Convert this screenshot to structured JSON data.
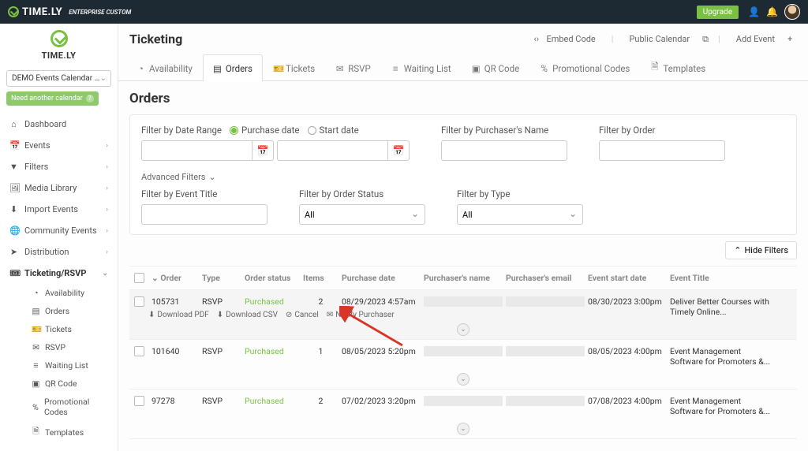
{
  "topbar": {
    "brand": "TIME.LY",
    "brand_sub": "ENTERPRISE CUSTOM",
    "upgrade": "Upgrade"
  },
  "sidebar": {
    "brand": "TIME.LY",
    "calendar_selected": "DEMO Events Calendar (M...",
    "need_calendar": "Need another calendar",
    "items": [
      {
        "icon": "⌂",
        "label": "Dashboard"
      },
      {
        "icon": "📅",
        "label": "Events",
        "chev": "›"
      },
      {
        "icon": "▼",
        "label": "Filters",
        "chev": "›"
      },
      {
        "icon": "🖼",
        "label": "Media Library",
        "chev": "›"
      },
      {
        "icon": "⬇",
        "label": "Import Events",
        "chev": "›"
      },
      {
        "icon": "🌐",
        "label": "Community Events",
        "chev": "›"
      },
      {
        "icon": "➤",
        "label": "Distribution",
        "chev": "›"
      },
      {
        "icon": "🎟",
        "label": "Ticketing/RSVP",
        "chev": "⌄",
        "active": true
      }
    ],
    "sub": [
      {
        "icon": "◔",
        "label": "Availability"
      },
      {
        "icon": "▤",
        "label": "Orders"
      },
      {
        "icon": "🎫",
        "label": "Tickets"
      },
      {
        "icon": "✉",
        "label": "RSVP"
      },
      {
        "icon": "≡",
        "label": "Waiting List"
      },
      {
        "icon": "▣",
        "label": "QR Code"
      },
      {
        "icon": "%",
        "label": "Promotional Codes"
      },
      {
        "icon": "🗎",
        "label": "Templates"
      }
    ]
  },
  "header": {
    "title": "Ticketing",
    "links": {
      "embed": "Embed Code",
      "public": "Public Calendar",
      "add": "Add Event"
    }
  },
  "tabs": [
    {
      "icon": "◔",
      "label": "Availability"
    },
    {
      "icon": "▤",
      "label": "Orders",
      "active": true
    },
    {
      "icon": "🎫",
      "label": "Tickets"
    },
    {
      "icon": "✉",
      "label": "RSVP"
    },
    {
      "icon": "≡",
      "label": "Waiting List"
    },
    {
      "icon": "▣",
      "label": "QR Code"
    },
    {
      "icon": "%",
      "label": "Promotional Codes"
    },
    {
      "icon": "🗎",
      "label": "Templates"
    }
  ],
  "page": {
    "title": "Orders",
    "filter_date_label": "Filter by Date Range",
    "purchase_date": "Purchase date",
    "start_date": "Start date",
    "filter_name": "Filter by Purchaser's Name",
    "filter_order": "Filter by Order",
    "advanced": "Advanced Filters",
    "filter_event": "Filter by Event Title",
    "filter_status": "Filter by Order Status",
    "filter_type": "Filter by Type",
    "all": "All",
    "hide": "Hide Filters"
  },
  "columns": {
    "order": "Order",
    "type": "Type",
    "status": "Order status",
    "items": "Items",
    "pdate": "Purchase date",
    "pname": "Purchaser's name",
    "pemail": "Purchaser's email",
    "estart": "Event start date",
    "etitle": "Event Title"
  },
  "rows": [
    {
      "order": "105731",
      "type": "RSVP",
      "status": "Purchased",
      "items": "2",
      "pdate": "08/29/2023 4:57am",
      "estart": "08/30/2023 3:00pm",
      "etitle": "Deliver Better Courses with Timely Online...",
      "highlight": true,
      "actions": true
    },
    {
      "order": "101640",
      "type": "RSVP",
      "status": "Purchased",
      "items": "1",
      "pdate": "08/05/2023 5:20pm",
      "estart": "08/05/2023 4:00pm",
      "etitle": "Event Management Software for Promoters &..."
    },
    {
      "order": "97278",
      "type": "RSVP",
      "status": "Purchased",
      "items": "2",
      "pdate": "07/02/2023 3:20pm",
      "estart": "07/08/2023 4:00pm",
      "etitle": "Event Management Software for Promoters &..."
    }
  ],
  "actions": {
    "pdf": "Download PDF",
    "csv": "Download CSV",
    "cancel": "Cancel",
    "notify": "Notify Purchaser"
  }
}
